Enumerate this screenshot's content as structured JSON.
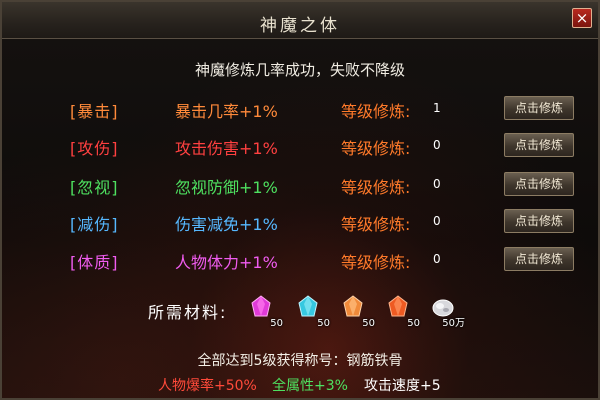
{
  "window": {
    "title": "神魔之体",
    "close_label": "×"
  },
  "subtitle": "神魔修炼几率成功，失败不降级",
  "rows": [
    {
      "tag": "[暴击]",
      "effect": "暴击几率+1%",
      "level_label": "等级修炼:",
      "level": "1",
      "button": "点击修炼",
      "color": "#ff8a3a"
    },
    {
      "tag": "[攻伤]",
      "effect": "攻击伤害+1%",
      "level_label": "等级修炼:",
      "level": "0",
      "button": "点击修炼",
      "color": "#ff4040"
    },
    {
      "tag": "[忽视]",
      "effect": "忽视防御+1%",
      "level_label": "等级修炼:",
      "level": "0",
      "button": "点击修炼",
      "color": "#4ee060"
    },
    {
      "tag": "[减伤]",
      "effect": "伤害减免+1%",
      "level_label": "等级修炼:",
      "level": "0",
      "button": "点击修炼",
      "color": "#56b8ff"
    },
    {
      "tag": "[体质]",
      "effect": "人物体力+1%",
      "level_label": "等级修炼:",
      "level": "0",
      "button": "点击修炼",
      "color": "#f05cf0"
    }
  ],
  "materials": {
    "label": "所需材料:",
    "items": [
      {
        "icon": "magenta-crystal-icon",
        "qty": "50",
        "color": "#e03ad8"
      },
      {
        "icon": "cyan-crystal-icon",
        "qty": "50",
        "color": "#36c8e0"
      },
      {
        "icon": "orange-crystal-icon",
        "qty": "50",
        "color": "#f08a3a"
      },
      {
        "icon": "red-orange-crystal-icon",
        "qty": "50",
        "color": "#ee5a22"
      },
      {
        "icon": "silver-ore-icon",
        "qty": "50万",
        "color": "#d8d8dc"
      }
    ]
  },
  "reward": {
    "line": "全部达到5级获得称号：钢筋铁骨",
    "bonuses": [
      {
        "text": "人物爆率+50%",
        "color": "#ff4a3a"
      },
      {
        "text": "全属性+3%",
        "color": "#4ee060"
      },
      {
        "text": "攻击速度+5",
        "color": "#ffffff"
      }
    ]
  }
}
